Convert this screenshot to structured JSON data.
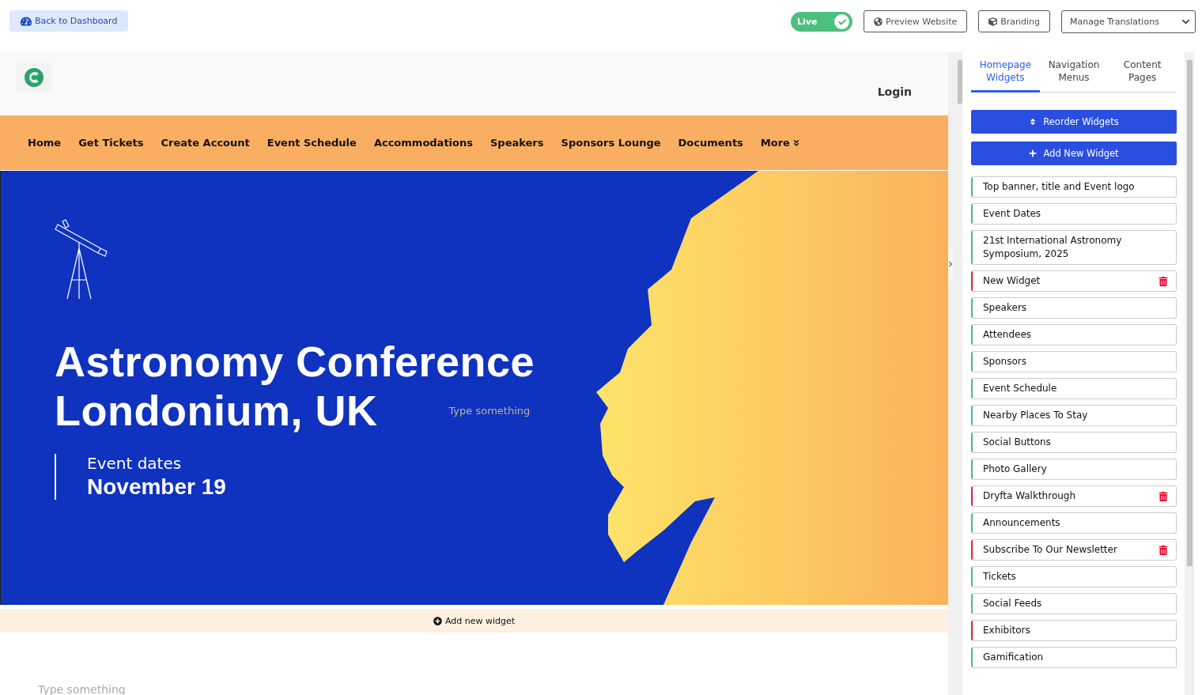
{
  "topbar": {
    "back_button": "Back to Dashboard",
    "live_toggle": {
      "label": "Live",
      "on": true
    },
    "preview_button": "Preview Website",
    "branding_button": "Branding",
    "translations_dropdown": "Manage Translations"
  },
  "preview": {
    "header": {
      "login": "Login"
    },
    "nav": [
      "Home",
      "Get Tickets",
      "Create Account",
      "Event Schedule",
      "Accommodations",
      "Speakers",
      "Sponsors Lounge",
      "Documents"
    ],
    "nav_more": "More",
    "hero": {
      "title_lines": [
        "Astronomy Conference",
        "Londonium, UK"
      ],
      "placeholder": "Type something",
      "dates_label": "Event dates",
      "dates_value": "November 19"
    },
    "add_widget": "Add new widget",
    "below_placeholder": "Type something"
  },
  "sidebar": {
    "tabs": [
      {
        "label": "Homepage Widgets",
        "selected": true
      },
      {
        "label": "Navigation Menus",
        "selected": false
      },
      {
        "label": "Content Pages",
        "selected": false
      }
    ],
    "reorder_button": "Reorder Widgets",
    "add_button": "Add New Widget",
    "widgets": [
      {
        "label": "Top banner, title and Event logo",
        "color": "#4cbb7f",
        "deletable": false
      },
      {
        "label": "Event Dates",
        "color": "#4cbb7f",
        "deletable": false
      },
      {
        "label": "21st International Astronomy Symposium, 2025",
        "color": "#4cbb7f",
        "deletable": false
      },
      {
        "label": "New Widget",
        "color": "#e8202a",
        "deletable": true
      },
      {
        "label": "Speakers",
        "color": "#4cbb7f",
        "deletable": false
      },
      {
        "label": "Attendees",
        "color": "#4cbb7f",
        "deletable": false
      },
      {
        "label": "Sponsors",
        "color": "#4cbb7f",
        "deletable": false
      },
      {
        "label": "Event Schedule",
        "color": "#4cbb7f",
        "deletable": false
      },
      {
        "label": "Nearby Places To Stay",
        "color": "#4cbb7f",
        "deletable": false
      },
      {
        "label": "Social Buttons",
        "color": "#4cbb7f",
        "deletable": false
      },
      {
        "label": "Photo Gallery",
        "color": "#4cbb7f",
        "deletable": false
      },
      {
        "label": "Dryfta Walkthrough",
        "color": "#e8202a",
        "deletable": true
      },
      {
        "label": "Announcements",
        "color": "#4cbb7f",
        "deletable": false
      },
      {
        "label": "Subscribe To Our Newsletter",
        "color": "#e8202a",
        "deletable": true
      },
      {
        "label": "Tickets",
        "color": "#4cbb7f",
        "deletable": false
      },
      {
        "label": "Social Feeds",
        "color": "#4cbb7f",
        "deletable": false
      },
      {
        "label": "Exhibitors",
        "color": "#e8202a",
        "deletable": false
      },
      {
        "label": "Gamification",
        "color": "#4cbb7f",
        "deletable": false
      }
    ]
  }
}
